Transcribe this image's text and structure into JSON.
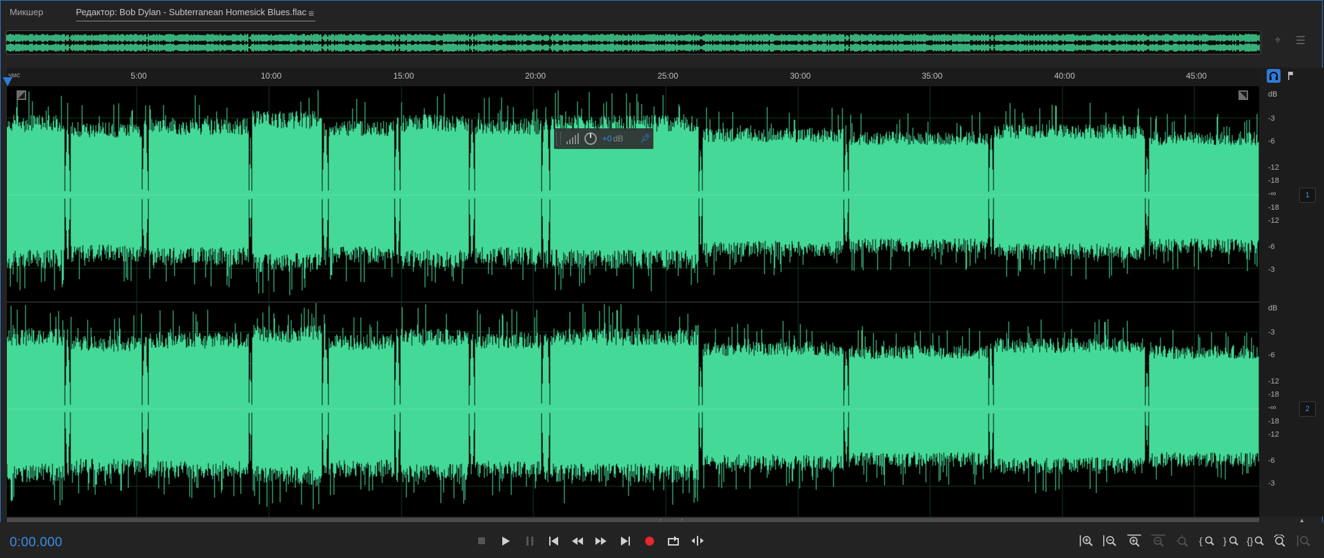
{
  "tabs": {
    "mixer": "Микшер",
    "editor": "Редактор: Bob Dylan - Subterranean Homesick Blues.flac"
  },
  "icons": {
    "tab_menu": "hamburger-menu-icon",
    "zoom_to_selection": "zoom-to-selection-icon",
    "list_view": "list-view-icon",
    "headphone": "headphone-icon",
    "marker": "marker-icon",
    "pin": "pin-icon"
  },
  "ruler": {
    "unit": "чмс",
    "labels": [
      "5:00",
      "10:00",
      "15:00",
      "20:00",
      "25:00",
      "30:00",
      "35:00",
      "40:00",
      "45:00"
    ]
  },
  "hud": {
    "volume_value": "+0",
    "unit": "dB"
  },
  "channels": [
    {
      "badge": "1",
      "db_header": "dB",
      "db_scale": [
        "-3",
        "-6",
        "-12",
        "-18",
        "-∞",
        "-18",
        "-12",
        "-6",
        "-3"
      ]
    },
    {
      "badge": "2",
      "db_header": "dB",
      "db_scale": [
        "-3",
        "-6",
        "-12",
        "-18",
        "-∞",
        "-18",
        "-12",
        "-6",
        "-3"
      ]
    }
  ],
  "transport": {
    "time": "0:00.000",
    "buttons": [
      "stop",
      "play",
      "pause",
      "go-to-start",
      "rewind",
      "fast-forward",
      "go-to-end",
      "record",
      "loop-playback",
      "skip-selection"
    ]
  },
  "zoom_tools": [
    "zoom-in-amplitude",
    "zoom-out-amplitude",
    "zoom-in-time",
    "zoom-out-time",
    "zoom-out-full",
    "zoom-in-at-start",
    "zoom-in-at-end",
    "zoom-to-selection",
    "zoom-reset",
    "zoom-selection-full"
  ],
  "colors": {
    "waveform": "#44d997",
    "accent": "#2f7ad8",
    "record": "#e8262c",
    "background": "#232323"
  }
}
